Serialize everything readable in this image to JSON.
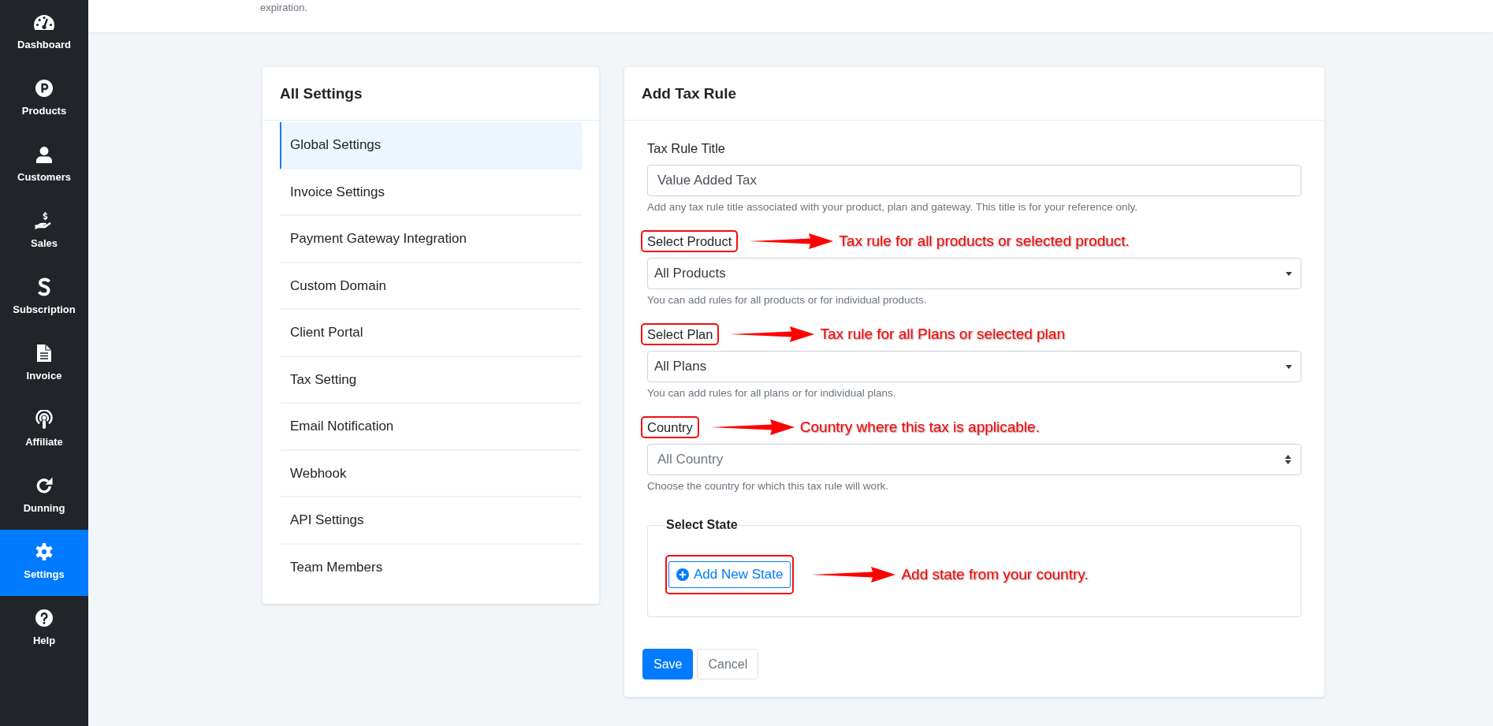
{
  "sidebar": {
    "items": [
      {
        "label": "Dashboard",
        "selected": false
      },
      {
        "label": "Products",
        "selected": false
      },
      {
        "label": "Customers",
        "selected": false
      },
      {
        "label": "Sales",
        "selected": false
      },
      {
        "label": "Subscription",
        "selected": false
      },
      {
        "label": "Invoice",
        "selected": false
      },
      {
        "label": "Affiliate",
        "selected": false
      },
      {
        "label": "Dunning",
        "selected": false
      },
      {
        "label": "Settings",
        "selected": true
      },
      {
        "label": "Help",
        "selected": false
      }
    ]
  },
  "top_bar": {
    "text": "expiration."
  },
  "settings_menu": {
    "title": "All Settings",
    "items": [
      {
        "label": "Global Settings",
        "selected": true
      },
      {
        "label": "Invoice Settings",
        "selected": false
      },
      {
        "label": "Payment Gateway Integration",
        "selected": false
      },
      {
        "label": "Custom Domain",
        "selected": false
      },
      {
        "label": "Client Portal",
        "selected": false
      },
      {
        "label": "Tax Setting",
        "selected": false
      },
      {
        "label": "Email Notification",
        "selected": false
      },
      {
        "label": "Webhook",
        "selected": false
      },
      {
        "label": "API Settings",
        "selected": false
      },
      {
        "label": "Team Members",
        "selected": false
      }
    ]
  },
  "tax_rule_form": {
    "title": "Add Tax Rule",
    "fields": [
      {
        "kind": "input",
        "label": "Tax Rule Title",
        "value": "Value Added Tax",
        "help": "Add any tax rule title associated with your product, plan and gateway. This title is for your reference only.",
        "highlighted": false
      },
      {
        "kind": "select",
        "label": "Select Product",
        "value": "All Products",
        "help": "You can add rules for all products or for individual products.",
        "highlighted": true,
        "callout": "Tax rule for all products or selected product."
      },
      {
        "kind": "select",
        "label": "Select Plan",
        "value": "All Plans",
        "help": "You can add rules for all plans or for individual plans.",
        "highlighted": true,
        "callout": "Tax rule for all Plans or selected plan"
      },
      {
        "kind": "custom-select",
        "label": "Country",
        "placeholder": "All Country",
        "help": "Choose the country for which this tax rule will work.",
        "highlighted": true,
        "callout": "Country where this tax is applicable."
      }
    ],
    "state_section": {
      "legend": "Select State",
      "add_button": {
        "label": "Add New State",
        "highlighted": true,
        "callout": "Add state from your country."
      }
    },
    "buttons": [
      {
        "kind": "primary",
        "label": "Save"
      },
      {
        "kind": "secondary",
        "label": "Cancel"
      }
    ]
  }
}
